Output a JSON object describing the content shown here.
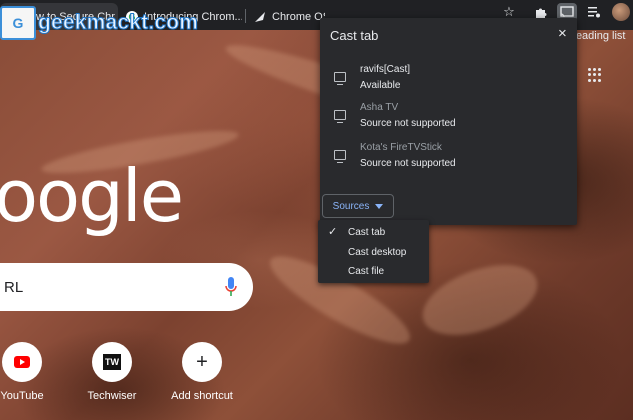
{
  "browser": {
    "tabs": [
      {
        "label": "How to Secure Chr",
        "favicon": "TA"
      },
      {
        "label": "Introducing Chrom...",
        "favicon": "G"
      },
      {
        "label": "Chrome OS",
        "favicon": "arrow"
      }
    ],
    "reading_list_label": "Reading list",
    "toolbar_icons": [
      "star-icon",
      "extension-icon",
      "cast-icon",
      "playlist-icon",
      "avatar"
    ]
  },
  "watermark": {
    "box_text": "G",
    "text": "geekmackt.com"
  },
  "newtab": {
    "logo_text": "oogle",
    "search_placeholder": "RL",
    "shortcuts": [
      {
        "label": "YouTube",
        "icon": "youtube-icon"
      },
      {
        "label": "Techwiser",
        "icon": "techwiser-icon",
        "icon_text": "TW"
      },
      {
        "label": "Add shortcut",
        "icon": "add-icon",
        "icon_text": "+"
      }
    ]
  },
  "cast_dialog": {
    "title": "Cast tab",
    "close_icon": "×",
    "sinks": [
      {
        "name": "ravifs[Cast]",
        "status": "Available",
        "enabled": true
      },
      {
        "name": "Asha TV",
        "status": "Source not supported",
        "enabled": false
      },
      {
        "name": "Kota's FireTVStick",
        "status": "Source not supported",
        "enabled": false
      }
    ],
    "sources_label": "Sources",
    "sources_menu": [
      {
        "label": "Cast tab",
        "checked": true
      },
      {
        "label": "Cast desktop",
        "checked": false
      },
      {
        "label": "Cast file",
        "checked": false
      }
    ]
  },
  "colors": {
    "accent": "#8ab4f8",
    "panel": "#292a2d",
    "tabbar": "#202124"
  }
}
